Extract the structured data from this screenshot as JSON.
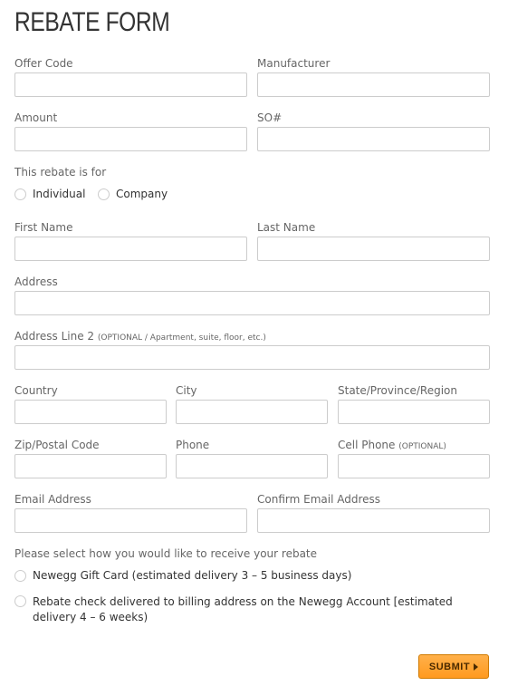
{
  "title": "REBATE FORM",
  "fields": {
    "offer_code": {
      "label": "Offer Code",
      "value": ""
    },
    "manufacturer": {
      "label": "Manufacturer",
      "value": ""
    },
    "amount": {
      "label": "Amount",
      "value": ""
    },
    "so_number": {
      "label": "SO#",
      "value": ""
    },
    "first_name": {
      "label": "First Name",
      "value": ""
    },
    "last_name": {
      "label": "Last Name",
      "value": ""
    },
    "address": {
      "label": "Address",
      "value": ""
    },
    "address2": {
      "label": "Address Line 2",
      "note": "(OPTIONAL / Apartment, suite, floor, etc.)",
      "value": ""
    },
    "country": {
      "label": "Country",
      "value": ""
    },
    "city": {
      "label": "City",
      "value": ""
    },
    "state": {
      "label": "State/Province/Region",
      "value": ""
    },
    "zip": {
      "label": "Zip/Postal Code",
      "value": ""
    },
    "phone": {
      "label": "Phone",
      "value": ""
    },
    "cell_phone": {
      "label": "Cell Phone",
      "note": "(OPTIONAL)",
      "value": ""
    },
    "email": {
      "label": "Email Address",
      "value": ""
    },
    "confirm_email": {
      "label": "Confirm Email Address",
      "value": ""
    }
  },
  "rebate_for": {
    "label": "This rebate is for",
    "options": [
      "Individual",
      "Company"
    ]
  },
  "delivery": {
    "label": "Please select how you would like to receive your rebate",
    "options": [
      "Newegg Gift Card (estimated delivery 3 – 5 business days)",
      "Rebate check delivered to billing address on the Newegg Account [estimated delivery 4 – 6 weeks)"
    ]
  },
  "submit_label": "SUBMIT"
}
